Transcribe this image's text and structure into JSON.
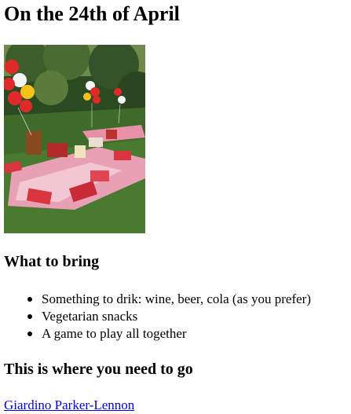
{
  "header": {
    "title": "On the 24th of April"
  },
  "photo": {
    "subject_icon": "picnic-photo",
    "colors": {
      "grass": "#3f6b2a",
      "trees": "#2c4a22",
      "blanket": "#e8a0b4",
      "cushion": "#d8353f",
      "balloon_red": "#e02a2a",
      "balloon_white": "#f4f4f4",
      "balloon_yellow": "#f3c21b"
    }
  },
  "bring": {
    "title": "What to bring",
    "items": [
      "Something to drik: wine, beer, cola (as you prefer)",
      "Vegetarian snacks",
      "A game to play all together"
    ]
  },
  "directions": {
    "title": "This is where you need to go",
    "link_text": "Giardino Parker-Lennon"
  },
  "colors": {
    "link": "#0000ee",
    "text": "#000000",
    "background": "#ffffff"
  }
}
